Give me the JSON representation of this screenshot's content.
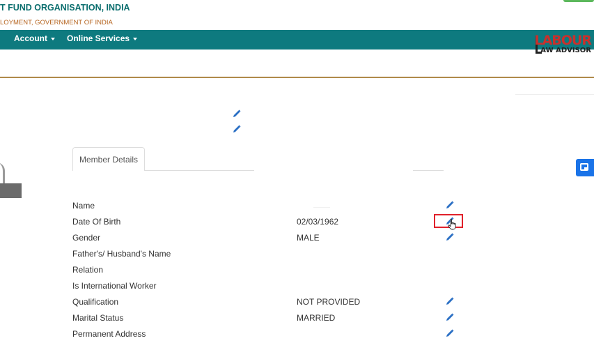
{
  "header": {
    "org_title": "T FUND ORGANISATION, INDIA",
    "org_subtitle": "LOYMENT, GOVERNMENT OF INDIA"
  },
  "navbar": {
    "items": [
      {
        "label": "Account"
      },
      {
        "label": "Online Services"
      }
    ]
  },
  "logo": {
    "big_text": "LABOUR",
    "small_text": "AW ADVISOR"
  },
  "tabs": [
    {
      "label": "Member Details",
      "active": true
    }
  ],
  "member_details": {
    "rows": [
      {
        "label": "Name",
        "value": "",
        "editable": true
      },
      {
        "label": "Date Of Birth",
        "value": "02/03/1962",
        "editable": true
      },
      {
        "label": "Gender",
        "value": "MALE",
        "editable": true
      },
      {
        "label": "Father's/ Husband's Name",
        "value": "",
        "editable": false
      },
      {
        "label": "Relation",
        "value": "",
        "editable": false
      },
      {
        "label": "Is International Worker",
        "value": "",
        "editable": false
      },
      {
        "label": "Qualification",
        "value": "NOT PROVIDED",
        "editable": true
      },
      {
        "label": "Marital Status",
        "value": "MARRIED",
        "editable": true
      },
      {
        "label": "Permanent Address",
        "value": "",
        "editable": true
      }
    ]
  },
  "colors": {
    "navbar": "#0e7a7f",
    "title": "#0b6e6e",
    "subtitle": "#b5631d",
    "pencil": "#2a6fc4",
    "highlight": "#e0212b"
  },
  "icons": {
    "edit": "pencil-icon",
    "caret": "caret-down-icon",
    "floating": "picture-in-picture-icon",
    "pointer": "hand-pointer-icon"
  }
}
